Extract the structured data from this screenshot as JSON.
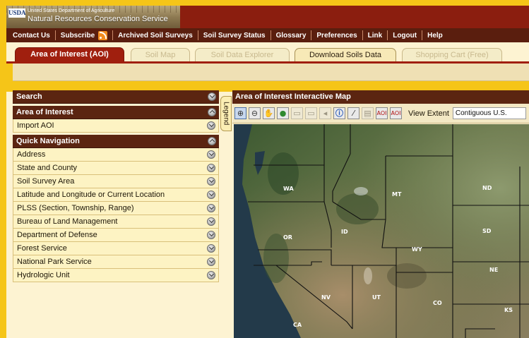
{
  "header": {
    "logo_mark": "USDA",
    "agency_small": "United States Department of Agriculture",
    "agency_name": "Natural Resources Conservation Service"
  },
  "topnav": {
    "items": [
      "Contact Us",
      "Subscribe",
      "Archived Soil Surveys",
      "Soil Survey Status",
      "Glossary",
      "Preferences",
      "Link",
      "Logout",
      "Help"
    ]
  },
  "tabs": [
    {
      "label": "Area of Interest (AOI)",
      "state": "active"
    },
    {
      "label": "Soil Map",
      "state": "disabled"
    },
    {
      "label": "Soil Data Explorer",
      "state": "disabled"
    },
    {
      "label": "Download Soils Data",
      "state": "enabled"
    },
    {
      "label": "Shopping Cart (Free)",
      "state": "disabled"
    }
  ],
  "left_panel": {
    "search": {
      "title": "Search"
    },
    "aoi": {
      "title": "Area of Interest",
      "items": [
        "Import AOI"
      ]
    },
    "quick_nav": {
      "title": "Quick Navigation",
      "items": [
        "Address",
        "State and County",
        "Soil Survey Area",
        "Latitude and Longitude or Current Location",
        "PLSS (Section, Township, Range)",
        "Bureau of Land Management",
        "Department of Defense",
        "Forest Service",
        "National Park Service",
        "Hydrologic Unit"
      ]
    }
  },
  "legend": {
    "label": "Legend"
  },
  "map_panel": {
    "title": "Area of Interest Interactive Map",
    "tools": [
      "zoom-in",
      "zoom-out",
      "pan",
      "full-extent",
      "previous-extent",
      "next-extent",
      "back",
      "identify",
      "measure",
      "print",
      "define-aoi-rectangle",
      "define-aoi-polygon"
    ],
    "view_extent_label": "View Extent",
    "view_extent_value": "Contiguous U.S.",
    "state_labels": [
      "WA",
      "MT",
      "ND",
      "OR",
      "ID",
      "SD",
      "WY",
      "NE",
      "NV",
      "UT",
      "CO",
      "KS",
      "CA"
    ]
  },
  "colors": {
    "page_border": "#f5c518",
    "header_red": "#8b1e0f",
    "nav_brown": "#5a1e0e",
    "section_brown": "#5b2511",
    "row_cream": "#fdf3c3",
    "active_tab": "#a01f0e"
  }
}
